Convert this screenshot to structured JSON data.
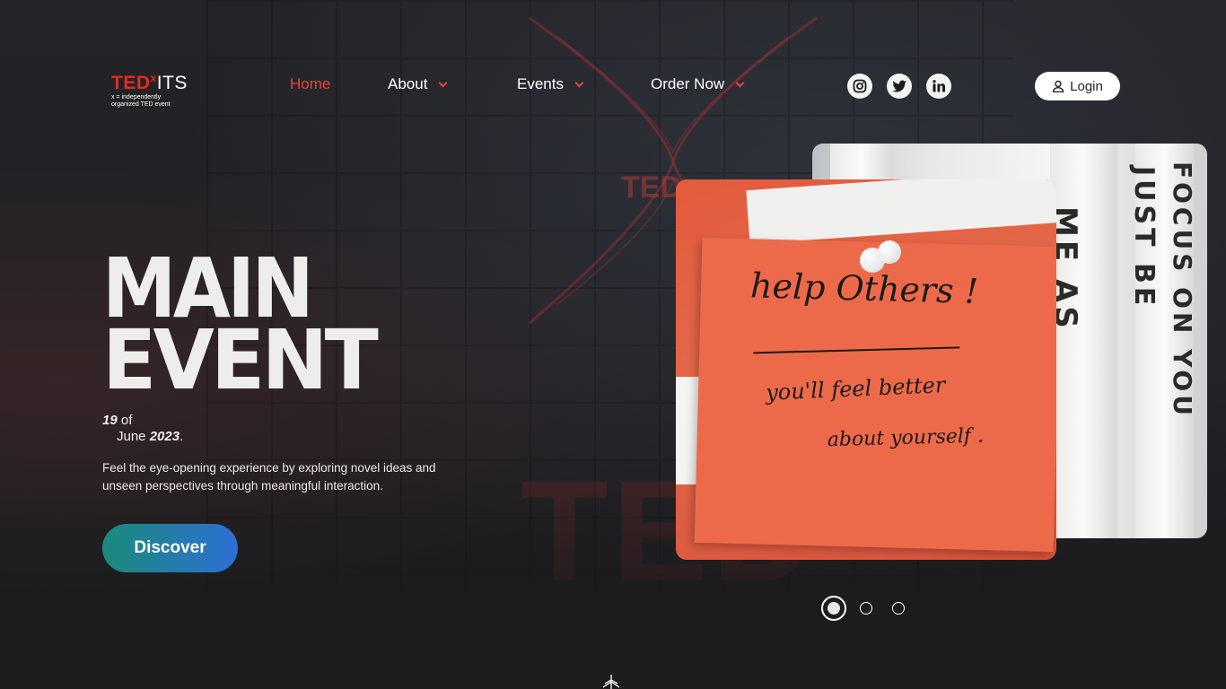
{
  "header": {
    "logo": {
      "main_ted": "TED",
      "main_x": "x",
      "main_its": "ITS",
      "sub_line1": "x = independently",
      "sub_line2": "organized TED event"
    },
    "nav": [
      {
        "label": "Home",
        "active": true
      },
      {
        "label": "About",
        "has_dropdown": true
      },
      {
        "label": "Events",
        "has_dropdown": true
      },
      {
        "label": "Order Now",
        "has_dropdown": true
      }
    ],
    "social": [
      "instagram-icon",
      "twitter-icon",
      "linkedin-icon"
    ],
    "login_label": "Login"
  },
  "hero": {
    "title_line1": "MAIN",
    "title_line2": "EVENT",
    "date_day": "19",
    "date_of": "of",
    "date_month": "June",
    "date_year": "2023",
    "date_period": ".",
    "description": "Feel the eye-opening experience by exploring novel ideas and unseen perspectives through meaningful interaction.",
    "cta_label": "Discover"
  },
  "carousel": {
    "note_line1": "help Others !",
    "note_line2": "you'll feel better",
    "note_line3": "about yourself .",
    "banner_left": "ME AS",
    "banner_mid": "JUST BE",
    "banner_right": "FOCUS ON YOU",
    "slides": 3,
    "active_slide": 1
  },
  "colors": {
    "accent": "#e62b1e",
    "cta_start": "#1a8a7a",
    "cta_end": "#2e6fd6",
    "background": "#1c1c1e"
  }
}
